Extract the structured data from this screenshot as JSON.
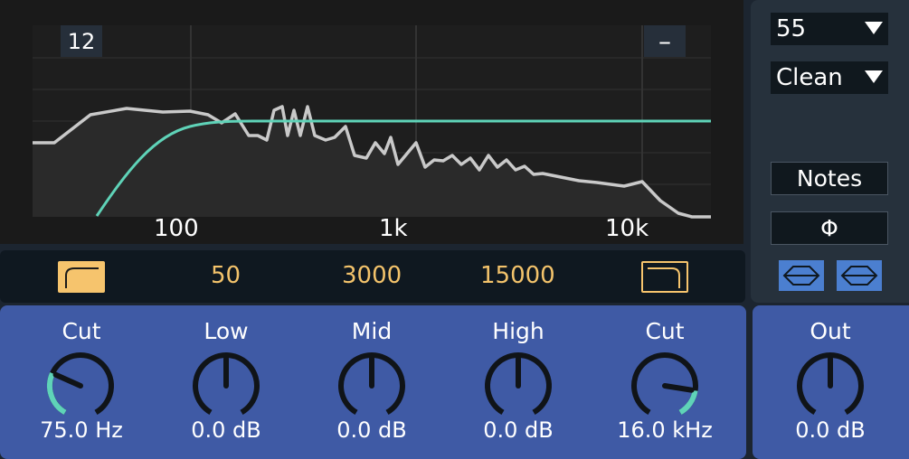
{
  "display": {
    "db_range": "12",
    "collapse_label": "–",
    "freq_labels": [
      "100",
      "1k",
      "10k"
    ]
  },
  "filter_strip": {
    "low_freq": "50",
    "mid_freq": "3000",
    "high_freq": "15000"
  },
  "knobs": [
    {
      "title": "Cut",
      "value": "75.0 Hz",
      "level": 0.28
    },
    {
      "title": "Low",
      "value": "0.0 dB",
      "level": 0.5
    },
    {
      "title": "Mid",
      "value": "0.0 dB",
      "level": 0.5
    },
    {
      "title": "High",
      "value": "0.0 dB",
      "level": 0.5
    },
    {
      "title": "Cut",
      "value": "16.0 kHz",
      "level": 0.83
    }
  ],
  "output": {
    "title": "Out",
    "value": "0.0 dB",
    "level": 0.5
  },
  "sidebar": {
    "preset_value": "55",
    "mode_value": "Clean",
    "notes_label": "Notes",
    "phase_symbol": "Φ"
  },
  "colors": {
    "accent_teal": "#5fd3b8",
    "accent_yellow": "#f6c46d",
    "panel_blue": "#3f5aa5",
    "mode_button_blue": "#4b7fd0"
  }
}
